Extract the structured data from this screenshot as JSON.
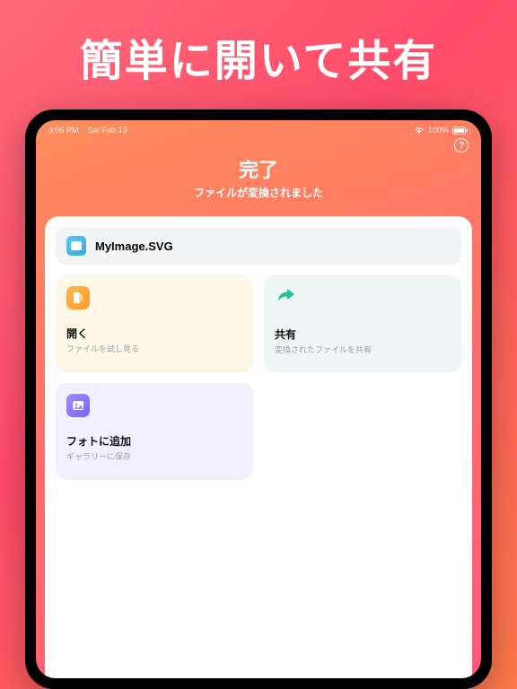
{
  "promo": {
    "title": "簡単に開いて共有"
  },
  "status": {
    "time": "3:06 PM",
    "date": "Sat Feb 13",
    "battery": "100%"
  },
  "help": {
    "label": "?"
  },
  "header": {
    "title": "完了",
    "subtitle": "ファイルが変換されました"
  },
  "file": {
    "name": "MyImage.SVG"
  },
  "cards": {
    "open": {
      "title": "開く",
      "subtitle": "ファイルを試し見る"
    },
    "share": {
      "title": "共有",
      "subtitle": "変換されたファイルを共有"
    },
    "photos": {
      "title": "フォトに追加",
      "subtitle": "ギャラリーに保存"
    }
  }
}
